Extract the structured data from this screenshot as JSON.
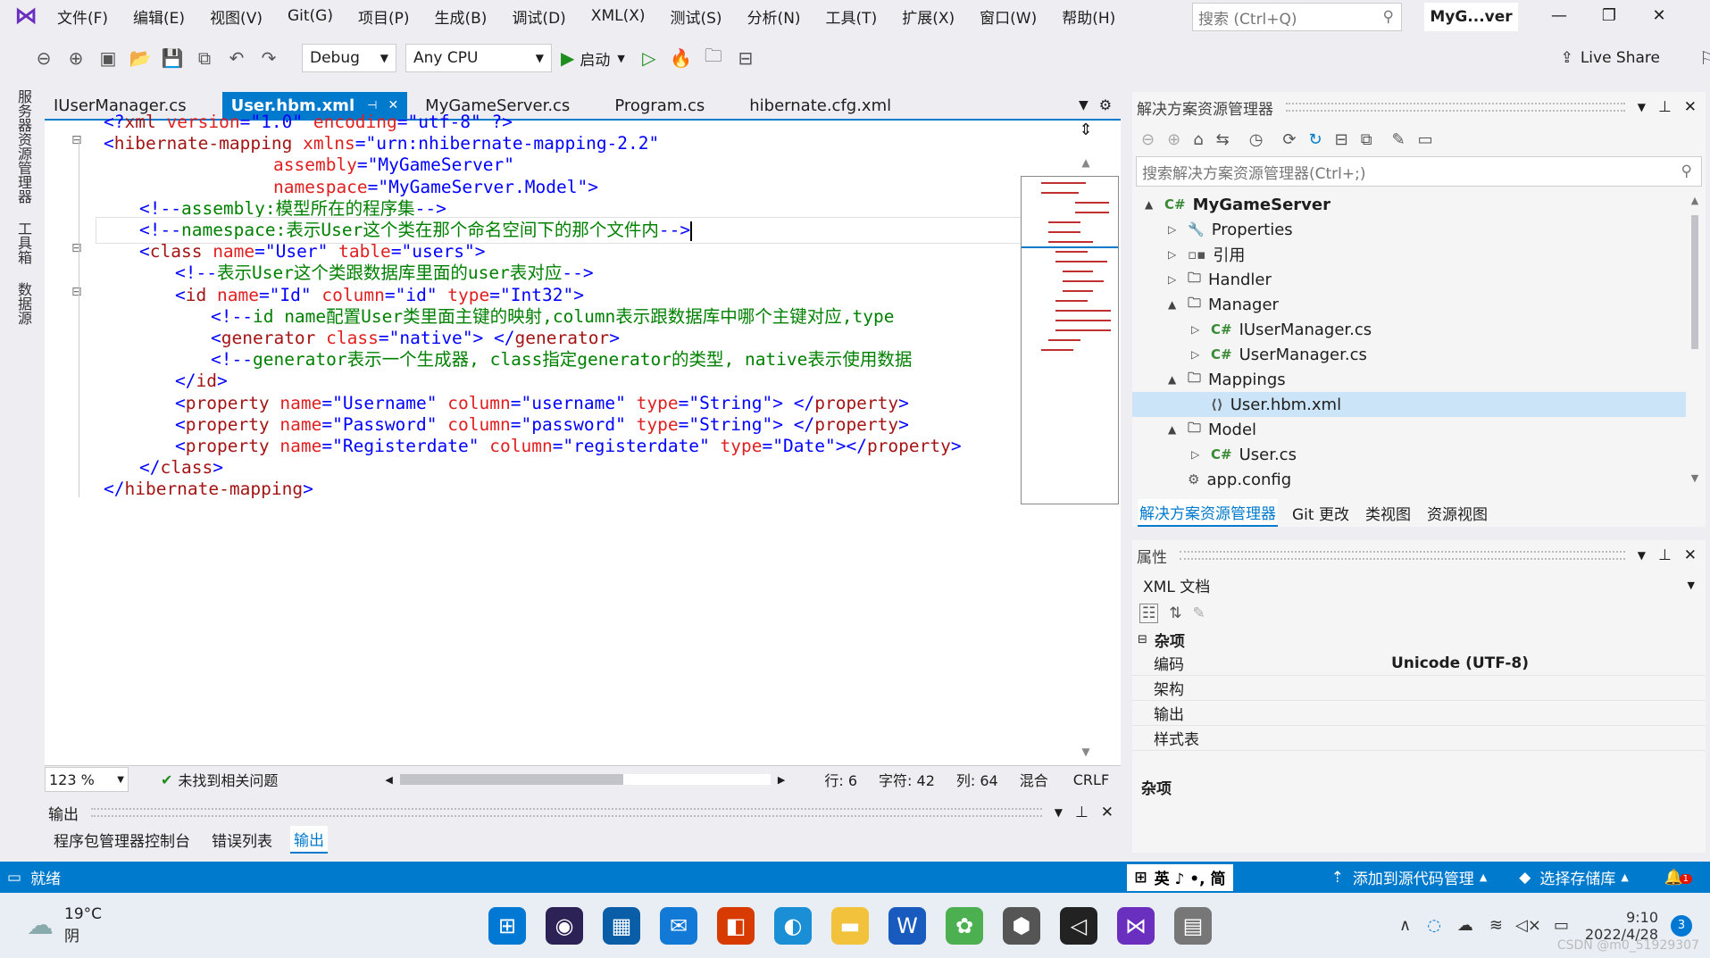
{
  "menu": [
    "文件(F)",
    "编辑(E)",
    "视图(V)",
    "Git(G)",
    "项目(P)",
    "生成(B)",
    "调试(D)",
    "XML(X)",
    "测试(S)",
    "分析(N)",
    "工具(T)",
    "扩展(X)",
    "窗口(W)",
    "帮助(H)"
  ],
  "search": {
    "placeholder": "搜索 (Ctrl+Q)"
  },
  "window": {
    "title": "MyG...ver"
  },
  "toolbar": {
    "config": "Debug",
    "platform": "Any CPU",
    "start_label": "启动",
    "live_share": "Live Share"
  },
  "left_rail": [
    "服务器资源管理器",
    "工具箱",
    "数据源"
  ],
  "tabs": [
    {
      "label": "IUserManager.cs",
      "active": false
    },
    {
      "label": "User.hbm.xml",
      "active": true
    },
    {
      "label": "MyGameServer.cs",
      "active": false
    },
    {
      "label": "Program.cs",
      "active": false
    },
    {
      "label": "hibernate.cfg.xml",
      "active": false
    }
  ],
  "code": [
    {
      "indent": 0,
      "parts": [
        [
          "k-bracket",
          "<?"
        ],
        [
          "k-tag",
          "xml"
        ],
        [
          "k-attr",
          " version"
        ],
        [
          "k-bracket",
          "=\""
        ],
        [
          "k-val",
          "1.0"
        ],
        [
          "k-bracket",
          "\""
        ],
        [
          "k-attr",
          " encoding"
        ],
        [
          "k-bracket",
          "=\""
        ],
        [
          "k-val",
          "utf-8"
        ],
        [
          "k-bracket",
          "\" ?>"
        ]
      ]
    },
    {
      "indent": 0,
      "parts": [
        [
          "k-bracket",
          "<"
        ],
        [
          "k-tag",
          "hibernate-mapping"
        ],
        [
          "k-attr",
          " xmlns"
        ],
        [
          "k-bracket",
          "=\""
        ],
        [
          "k-val",
          "urn:nhibernate-mapping-2.2"
        ],
        [
          "k-bracket",
          "\""
        ]
      ]
    },
    {
      "indent": 19,
      "parts": [
        [
          "k-attr",
          "assembly"
        ],
        [
          "k-bracket",
          "=\""
        ],
        [
          "k-val",
          "MyGameServer"
        ],
        [
          "k-bracket",
          "\""
        ]
      ]
    },
    {
      "indent": 19,
      "parts": [
        [
          "k-attr",
          "namespace"
        ],
        [
          "k-bracket",
          "=\""
        ],
        [
          "k-val",
          "MyGameServer.Model"
        ],
        [
          "k-bracket",
          "\">"
        ]
      ]
    },
    {
      "indent": 4,
      "parts": [
        [
          "k-bracket",
          "<!--"
        ],
        [
          "k-comment",
          "assembly:模型所在的程序集"
        ],
        [
          "k-bracket",
          "-->"
        ]
      ]
    },
    {
      "indent": 4,
      "parts": [
        [
          "k-bracket",
          "<!--"
        ],
        [
          "k-comment",
          "namespace:表示User这个类在那个命名空间下的那个文件内"
        ],
        [
          "k-bracket",
          "-->"
        ]
      ]
    },
    {
      "indent": 4,
      "parts": [
        [
          "k-bracket",
          "<"
        ],
        [
          "k-tag",
          "class"
        ],
        [
          "k-attr",
          " name"
        ],
        [
          "k-bracket",
          "=\""
        ],
        [
          "k-val",
          "User"
        ],
        [
          "k-bracket",
          "\""
        ],
        [
          "k-attr",
          " table"
        ],
        [
          "k-bracket",
          "=\""
        ],
        [
          "k-val",
          "users"
        ],
        [
          "k-bracket",
          "\">"
        ]
      ]
    },
    {
      "indent": 8,
      "parts": [
        [
          "k-bracket",
          "<!--"
        ],
        [
          "k-comment",
          "表示User这个类跟数据库里面的user表对应"
        ],
        [
          "k-bracket",
          "-->"
        ]
      ]
    },
    {
      "indent": 8,
      "parts": [
        [
          "k-bracket",
          "<"
        ],
        [
          "k-tag",
          "id"
        ],
        [
          "k-attr",
          " name"
        ],
        [
          "k-bracket",
          "=\""
        ],
        [
          "k-val",
          "Id"
        ],
        [
          "k-bracket",
          "\""
        ],
        [
          "k-attr",
          " column"
        ],
        [
          "k-bracket",
          "=\""
        ],
        [
          "k-val",
          "id"
        ],
        [
          "k-bracket",
          "\""
        ],
        [
          "k-attr",
          " type"
        ],
        [
          "k-bracket",
          "=\""
        ],
        [
          "k-val",
          "Int32"
        ],
        [
          "k-bracket",
          "\">"
        ]
      ]
    },
    {
      "indent": 12,
      "parts": [
        [
          "k-bracket",
          "<!--"
        ],
        [
          "k-comment",
          "id name配置User类里面主键的映射,column表示跟数据库中哪个主键对应,type"
        ]
      ]
    },
    {
      "indent": 12,
      "parts": [
        [
          "k-bracket",
          "<"
        ],
        [
          "k-tag",
          "generator"
        ],
        [
          "k-attr",
          " class"
        ],
        [
          "k-bracket",
          "=\""
        ],
        [
          "k-val",
          "native"
        ],
        [
          "k-bracket",
          "\"> </"
        ],
        [
          "k-tag",
          "generator"
        ],
        [
          "k-bracket",
          ">"
        ]
      ]
    },
    {
      "indent": 12,
      "parts": [
        [
          "k-bracket",
          "<!--"
        ],
        [
          "k-comment",
          "generator表示一个生成器, class指定generator的类型, native表示使用数据"
        ]
      ]
    },
    {
      "indent": 8,
      "parts": [
        [
          "k-bracket",
          "</"
        ],
        [
          "k-tag",
          "id"
        ],
        [
          "k-bracket",
          ">"
        ]
      ]
    },
    {
      "indent": 8,
      "parts": [
        [
          "k-bracket",
          "<"
        ],
        [
          "k-tag",
          "property"
        ],
        [
          "k-attr",
          " name"
        ],
        [
          "k-bracket",
          "=\""
        ],
        [
          "k-val",
          "Username"
        ],
        [
          "k-bracket",
          "\""
        ],
        [
          "k-attr",
          " column"
        ],
        [
          "k-bracket",
          "=\""
        ],
        [
          "k-val",
          "username"
        ],
        [
          "k-bracket",
          "\""
        ],
        [
          "k-attr",
          " type"
        ],
        [
          "k-bracket",
          "=\""
        ],
        [
          "k-val",
          "String"
        ],
        [
          "k-bracket",
          "\"> </"
        ],
        [
          "k-tag",
          "property"
        ],
        [
          "k-bracket",
          ">"
        ]
      ]
    },
    {
      "indent": 8,
      "parts": [
        [
          "k-bracket",
          "<"
        ],
        [
          "k-tag",
          "property"
        ],
        [
          "k-attr",
          " name"
        ],
        [
          "k-bracket",
          "=\""
        ],
        [
          "k-val",
          "Password"
        ],
        [
          "k-bracket",
          "\""
        ],
        [
          "k-attr",
          " column"
        ],
        [
          "k-bracket",
          "=\""
        ],
        [
          "k-val",
          "password"
        ],
        [
          "k-bracket",
          "\""
        ],
        [
          "k-attr",
          " type"
        ],
        [
          "k-bracket",
          "=\""
        ],
        [
          "k-val",
          "String"
        ],
        [
          "k-bracket",
          "\"> </"
        ],
        [
          "k-tag",
          "property"
        ],
        [
          "k-bracket",
          ">"
        ]
      ]
    },
    {
      "indent": 8,
      "parts": [
        [
          "k-bracket",
          "<"
        ],
        [
          "k-tag",
          "property"
        ],
        [
          "k-attr",
          " name"
        ],
        [
          "k-bracket",
          "=\""
        ],
        [
          "k-val",
          "Registerdate"
        ],
        [
          "k-bracket",
          "\""
        ],
        [
          "k-attr",
          " column"
        ],
        [
          "k-bracket",
          "=\""
        ],
        [
          "k-val",
          "registerdate"
        ],
        [
          "k-bracket",
          "\""
        ],
        [
          "k-attr",
          " type"
        ],
        [
          "k-bracket",
          "=\""
        ],
        [
          "k-val",
          "Date"
        ],
        [
          "k-bracket",
          "\"></"
        ],
        [
          "k-tag",
          "property"
        ],
        [
          "k-bracket",
          ">"
        ]
      ]
    },
    {
      "indent": 4,
      "parts": [
        [
          "k-bracket",
          "</"
        ],
        [
          "k-tag",
          "class"
        ],
        [
          "k-bracket",
          ">"
        ]
      ]
    },
    {
      "indent": 0,
      "parts": [
        [
          "k-bracket",
          "</"
        ],
        [
          "k-tag",
          "hibernate-mapping"
        ],
        [
          "k-bracket",
          ">"
        ]
      ]
    }
  ],
  "editor_status": {
    "zoom": "123 %",
    "issues": "未找到相关问题",
    "line": "行: 6",
    "char": "字符: 42",
    "col": "列: 64",
    "mixed": "混合",
    "eol": "CRLF"
  },
  "output": {
    "title": "输出",
    "tabs": [
      "程序包管理器控制台",
      "错误列表",
      "输出"
    ],
    "active_tab": 2
  },
  "solution": {
    "title": "解决方案资源管理器",
    "search_placeholder": "搜索解决方案资源管理器(Ctrl+;)",
    "tree": [
      {
        "level": 0,
        "label": "MyGameServer",
        "icon": "C#",
        "expand": "▲",
        "bold": true
      },
      {
        "level": 1,
        "label": "Properties",
        "icon": "wrench-icon",
        "expand": "▷"
      },
      {
        "level": 1,
        "label": "引用",
        "icon": "references-icon",
        "expand": "▷"
      },
      {
        "level": 1,
        "label": "Handler",
        "icon": "folder-icon",
        "expand": "▷"
      },
      {
        "level": 1,
        "label": "Manager",
        "icon": "folder-icon",
        "expand": "▲"
      },
      {
        "level": 2,
        "label": "IUserManager.cs",
        "icon": "C#",
        "expand": "▷"
      },
      {
        "level": 2,
        "label": "UserManager.cs",
        "icon": "C#",
        "expand": "▷"
      },
      {
        "level": 1,
        "label": "Mappings",
        "icon": "folder-icon",
        "expand": "▲"
      },
      {
        "level": 2,
        "label": "User.hbm.xml",
        "icon": "xml-icon",
        "expand": "",
        "selected": true
      },
      {
        "level": 1,
        "label": "Model",
        "icon": "folder-icon",
        "expand": "▲"
      },
      {
        "level": 2,
        "label": "User.cs",
        "icon": "C#",
        "expand": "▷"
      },
      {
        "level": 1,
        "label": "app.config",
        "icon": "config-icon",
        "expand": ""
      }
    ],
    "bottom_tabs": [
      "解决方案资源管理器",
      "Git 更改",
      "类视图",
      "资源视图"
    ]
  },
  "properties": {
    "title": "属性",
    "object": "XML 文档",
    "category": "杂项",
    "rows": [
      {
        "name": "编码",
        "value": "Unicode (UTF-8)"
      },
      {
        "name": "架构",
        "value": ""
      },
      {
        "name": "输出",
        "value": ""
      },
      {
        "name": "样式表",
        "value": ""
      }
    ],
    "desc": "杂项"
  },
  "statusbar": {
    "ready": "就绪",
    "ime": "英 ♪ •, 简",
    "source_control": "添加到源代码管理",
    "repo": "选择存储库",
    "notifications": "1"
  },
  "taskbar": {
    "weather_temp": "19°C",
    "weather_desc": "阴",
    "time": "9:10",
    "date": "2022/4/28",
    "badge": "3",
    "watermark": "CSDN @m0_51929307"
  },
  "colors": {
    "accent": "#007acc",
    "selected_row": "#cce4f7"
  }
}
